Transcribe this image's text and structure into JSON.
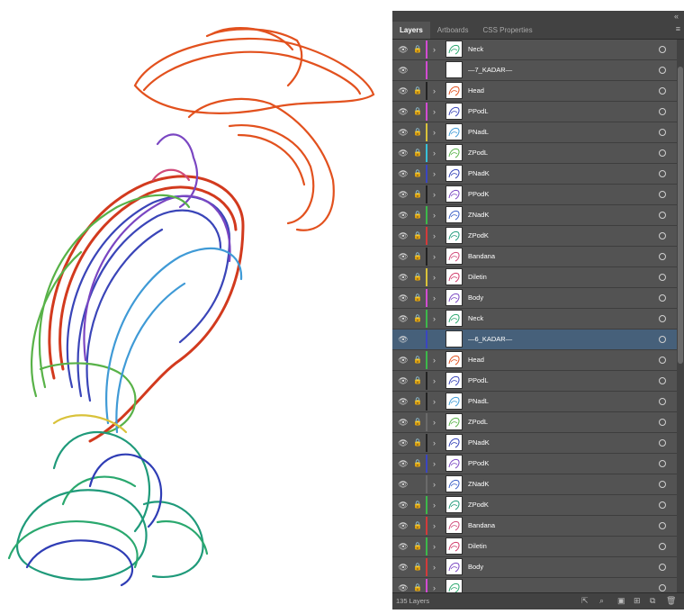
{
  "panel": {
    "tabs": [
      {
        "label": "Layers",
        "active": true
      },
      {
        "label": "Artboards",
        "active": false
      },
      {
        "label": "CSS Properties",
        "active": false
      }
    ],
    "collapse_icon": "double-chevron-icon",
    "menu_icon": "hamburger-menu-icon",
    "layer_count": "135 Layers"
  },
  "layers": [
    {
      "name": "Neck",
      "color": "#d24bd2",
      "locked": true,
      "expand": true,
      "stroke": "#2aa86e"
    },
    {
      "name": "—7_KADAR—",
      "color": "#d24bd2",
      "locked": false,
      "expand": false,
      "stroke": null
    },
    {
      "name": "Head",
      "color": "#222222",
      "locked": true,
      "expand": true,
      "stroke": "#e2511e"
    },
    {
      "name": "PPodL",
      "color": "#d24bd2",
      "locked": true,
      "expand": true,
      "stroke": "#3a45b8"
    },
    {
      "name": "PNadL",
      "color": "#d9c23a",
      "locked": true,
      "expand": true,
      "stroke": "#3f9ad6"
    },
    {
      "name": "ZPodL",
      "color": "#37c0d8",
      "locked": true,
      "expand": true,
      "stroke": "#58b248"
    },
    {
      "name": "PNadK",
      "color": "#3a46c0",
      "locked": true,
      "expand": true,
      "stroke": "#2f3db5"
    },
    {
      "name": "PPodK",
      "color": "#222222",
      "locked": true,
      "expand": true,
      "stroke": "#7a46c2"
    },
    {
      "name": "ZNadK",
      "color": "#3cb84a",
      "locked": true,
      "expand": true,
      "stroke": "#3a5ec6"
    },
    {
      "name": "ZPodK",
      "color": "#d23a3a",
      "locked": true,
      "expand": true,
      "stroke": "#1f9a7a"
    },
    {
      "name": "Bandana",
      "color": "#222222",
      "locked": true,
      "expand": true,
      "stroke": "#d04a7a"
    },
    {
      "name": "Diletin",
      "color": "#d9c23a",
      "locked": true,
      "expand": true,
      "stroke": "#d03a6a"
    },
    {
      "name": "Body",
      "color": "#d24bd2",
      "locked": true,
      "expand": true,
      "stroke": "#7a46c2"
    },
    {
      "name": "Neck",
      "color": "#3cb84a",
      "locked": true,
      "expand": true,
      "stroke": "#2aa86e"
    },
    {
      "name": "—6_KADAR—",
      "color": "#3a46c0",
      "locked": false,
      "expand": false,
      "stroke": null,
      "selected": true
    },
    {
      "name": "Head",
      "color": "#3cb84a",
      "locked": true,
      "expand": true,
      "stroke": "#e2511e"
    },
    {
      "name": "PPodL",
      "color": "#222222",
      "locked": true,
      "expand": true,
      "stroke": "#3a45b8"
    },
    {
      "name": "PNadL",
      "color": "#222222",
      "locked": true,
      "expand": true,
      "stroke": "#3f9ad6"
    },
    {
      "name": "ZPodL",
      "color": "#6a6a6a",
      "locked": true,
      "expand": true,
      "stroke": "#58b248"
    },
    {
      "name": "PNadK",
      "color": "#222222",
      "locked": true,
      "expand": true,
      "stroke": "#2f3db5"
    },
    {
      "name": "PPodK",
      "color": "#3a46c0",
      "locked": true,
      "expand": true,
      "stroke": "#7a46c2"
    },
    {
      "name": "ZNadK",
      "color": "#6a6a6a",
      "locked": false,
      "expand": true,
      "stroke": "#3a5ec6"
    },
    {
      "name": "ZPodK",
      "color": "#3cb84a",
      "locked": true,
      "expand": true,
      "stroke": "#1f9a7a"
    },
    {
      "name": "Bandana",
      "color": "#d23a3a",
      "locked": true,
      "expand": true,
      "stroke": "#d04a7a"
    },
    {
      "name": "Diletin",
      "color": "#3cb84a",
      "locked": true,
      "expand": true,
      "stroke": "#d03a6a"
    },
    {
      "name": "Body",
      "color": "#d23a3a",
      "locked": true,
      "expand": true,
      "stroke": "#7a46c2"
    },
    {
      "name": "",
      "color": "#d24bd2",
      "locked": true,
      "expand": true,
      "stroke": "#2aa86e"
    }
  ],
  "footer_icons": [
    "export-icon",
    "search-icon",
    "clipping-mask-icon",
    "new-sublayer-icon",
    "new-layer-icon",
    "trash-icon"
  ]
}
